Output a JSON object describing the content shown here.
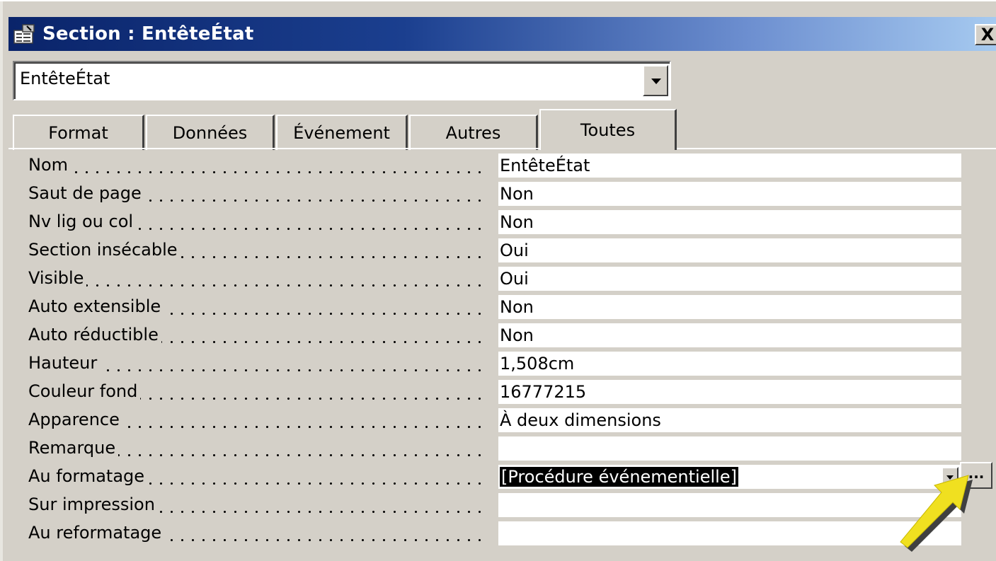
{
  "window": {
    "title": "Section : EntêteÉtat",
    "close_label": "X"
  },
  "object_selector": {
    "value": "EntêteÉtat"
  },
  "tabs": [
    {
      "label": "Format",
      "active": false
    },
    {
      "label": "Données",
      "active": false
    },
    {
      "label": "Événement",
      "active": false
    },
    {
      "label": "Autres",
      "active": false
    },
    {
      "label": "Toutes",
      "active": true
    }
  ],
  "properties": [
    {
      "label": "Nom",
      "value": "EntêteÉtat"
    },
    {
      "label": "Saut de page",
      "value": "Non"
    },
    {
      "label": "Nv lig ou col",
      "value": "Non"
    },
    {
      "label": "Section insécable",
      "value": "Oui"
    },
    {
      "label": "Visible",
      "value": "Oui"
    },
    {
      "label": "Auto extensible",
      "value": "Non"
    },
    {
      "label": "Auto réductible",
      "value": "Non"
    },
    {
      "label": "Hauteur",
      "value": "1,508cm"
    },
    {
      "label": "Couleur fond",
      "value": "16777215"
    },
    {
      "label": "Apparence",
      "value": "À deux dimensions"
    },
    {
      "label": "Remarque",
      "value": ""
    },
    {
      "label": "Au formatage",
      "value": "[Procédure événementielle]",
      "selected": true
    },
    {
      "label": "Sur impression",
      "value": ""
    },
    {
      "label": "Au reformatage",
      "value": ""
    }
  ],
  "build_button_label": "...",
  "colors": {
    "title_gradient_start": "#0a246a",
    "title_gradient_end": "#a6caf0",
    "dialog_bg": "#d4d0c8",
    "arrow": "#f0e020"
  }
}
